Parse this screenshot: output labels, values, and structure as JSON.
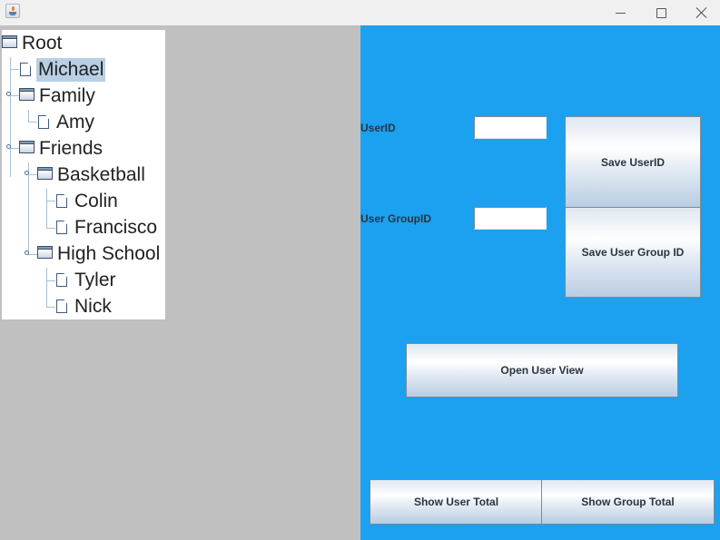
{
  "window": {
    "title": "",
    "icon": "java-cup-icon",
    "controls": {
      "minimize": "minimize-icon",
      "maximize": "maximize-icon",
      "close": "close-icon"
    }
  },
  "tree": {
    "nodes": [
      {
        "label": "Root",
        "type": "folder",
        "depth": 0
      },
      {
        "label": "Michael",
        "type": "file",
        "depth": 1,
        "selected": true
      },
      {
        "label": "Family",
        "type": "folder",
        "depth": 1
      },
      {
        "label": "Amy",
        "type": "file",
        "depth": 2
      },
      {
        "label": "Friends",
        "type": "folder",
        "depth": 1
      },
      {
        "label": "Basketball",
        "type": "folder",
        "depth": 2
      },
      {
        "label": "Colin",
        "type": "file",
        "depth": 3
      },
      {
        "label": "Francisco",
        "type": "file",
        "depth": 3
      },
      {
        "label": "High School",
        "type": "folder",
        "depth": 2
      },
      {
        "label": "Tyler",
        "type": "file",
        "depth": 3
      },
      {
        "label": "Nick",
        "type": "file",
        "depth": 3
      }
    ]
  },
  "form": {
    "user_id_label": "UserID",
    "user_id_value": "",
    "user_group_id_label": "User GroupID",
    "user_group_id_value": ""
  },
  "buttons": {
    "save_user_id": "Save UserID",
    "save_user_group_id": "Save User Group ID",
    "open_user_view": "Open User View",
    "show_user_total": "Show User Total",
    "show_group_total": "Show Group Total"
  },
  "colors": {
    "panel_blue": "#1ba1ef",
    "panel_gray": "#c0c0c0",
    "selection": "#b8cfe5"
  }
}
